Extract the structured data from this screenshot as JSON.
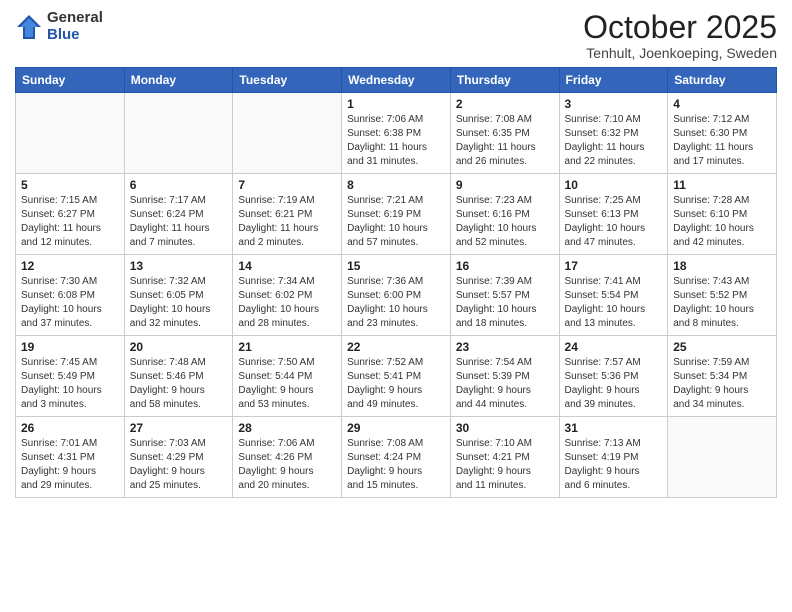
{
  "header": {
    "logo_general": "General",
    "logo_blue": "Blue",
    "month_title": "October 2025",
    "location": "Tenhult, Joenkoeping, Sweden"
  },
  "days_of_week": [
    "Sunday",
    "Monday",
    "Tuesday",
    "Wednesday",
    "Thursday",
    "Friday",
    "Saturday"
  ],
  "weeks": [
    [
      {
        "day": "",
        "info": ""
      },
      {
        "day": "",
        "info": ""
      },
      {
        "day": "",
        "info": ""
      },
      {
        "day": "1",
        "info": "Sunrise: 7:06 AM\nSunset: 6:38 PM\nDaylight: 11 hours\nand 31 minutes."
      },
      {
        "day": "2",
        "info": "Sunrise: 7:08 AM\nSunset: 6:35 PM\nDaylight: 11 hours\nand 26 minutes."
      },
      {
        "day": "3",
        "info": "Sunrise: 7:10 AM\nSunset: 6:32 PM\nDaylight: 11 hours\nand 22 minutes."
      },
      {
        "day": "4",
        "info": "Sunrise: 7:12 AM\nSunset: 6:30 PM\nDaylight: 11 hours\nand 17 minutes."
      }
    ],
    [
      {
        "day": "5",
        "info": "Sunrise: 7:15 AM\nSunset: 6:27 PM\nDaylight: 11 hours\nand 12 minutes."
      },
      {
        "day": "6",
        "info": "Sunrise: 7:17 AM\nSunset: 6:24 PM\nDaylight: 11 hours\nand 7 minutes."
      },
      {
        "day": "7",
        "info": "Sunrise: 7:19 AM\nSunset: 6:21 PM\nDaylight: 11 hours\nand 2 minutes."
      },
      {
        "day": "8",
        "info": "Sunrise: 7:21 AM\nSunset: 6:19 PM\nDaylight: 10 hours\nand 57 minutes."
      },
      {
        "day": "9",
        "info": "Sunrise: 7:23 AM\nSunset: 6:16 PM\nDaylight: 10 hours\nand 52 minutes."
      },
      {
        "day": "10",
        "info": "Sunrise: 7:25 AM\nSunset: 6:13 PM\nDaylight: 10 hours\nand 47 minutes."
      },
      {
        "day": "11",
        "info": "Sunrise: 7:28 AM\nSunset: 6:10 PM\nDaylight: 10 hours\nand 42 minutes."
      }
    ],
    [
      {
        "day": "12",
        "info": "Sunrise: 7:30 AM\nSunset: 6:08 PM\nDaylight: 10 hours\nand 37 minutes."
      },
      {
        "day": "13",
        "info": "Sunrise: 7:32 AM\nSunset: 6:05 PM\nDaylight: 10 hours\nand 32 minutes."
      },
      {
        "day": "14",
        "info": "Sunrise: 7:34 AM\nSunset: 6:02 PM\nDaylight: 10 hours\nand 28 minutes."
      },
      {
        "day": "15",
        "info": "Sunrise: 7:36 AM\nSunset: 6:00 PM\nDaylight: 10 hours\nand 23 minutes."
      },
      {
        "day": "16",
        "info": "Sunrise: 7:39 AM\nSunset: 5:57 PM\nDaylight: 10 hours\nand 18 minutes."
      },
      {
        "day": "17",
        "info": "Sunrise: 7:41 AM\nSunset: 5:54 PM\nDaylight: 10 hours\nand 13 minutes."
      },
      {
        "day": "18",
        "info": "Sunrise: 7:43 AM\nSunset: 5:52 PM\nDaylight: 10 hours\nand 8 minutes."
      }
    ],
    [
      {
        "day": "19",
        "info": "Sunrise: 7:45 AM\nSunset: 5:49 PM\nDaylight: 10 hours\nand 3 minutes."
      },
      {
        "day": "20",
        "info": "Sunrise: 7:48 AM\nSunset: 5:46 PM\nDaylight: 9 hours\nand 58 minutes."
      },
      {
        "day": "21",
        "info": "Sunrise: 7:50 AM\nSunset: 5:44 PM\nDaylight: 9 hours\nand 53 minutes."
      },
      {
        "day": "22",
        "info": "Sunrise: 7:52 AM\nSunset: 5:41 PM\nDaylight: 9 hours\nand 49 minutes."
      },
      {
        "day": "23",
        "info": "Sunrise: 7:54 AM\nSunset: 5:39 PM\nDaylight: 9 hours\nand 44 minutes."
      },
      {
        "day": "24",
        "info": "Sunrise: 7:57 AM\nSunset: 5:36 PM\nDaylight: 9 hours\nand 39 minutes."
      },
      {
        "day": "25",
        "info": "Sunrise: 7:59 AM\nSunset: 5:34 PM\nDaylight: 9 hours\nand 34 minutes."
      }
    ],
    [
      {
        "day": "26",
        "info": "Sunrise: 7:01 AM\nSunset: 4:31 PM\nDaylight: 9 hours\nand 29 minutes."
      },
      {
        "day": "27",
        "info": "Sunrise: 7:03 AM\nSunset: 4:29 PM\nDaylight: 9 hours\nand 25 minutes."
      },
      {
        "day": "28",
        "info": "Sunrise: 7:06 AM\nSunset: 4:26 PM\nDaylight: 9 hours\nand 20 minutes."
      },
      {
        "day": "29",
        "info": "Sunrise: 7:08 AM\nSunset: 4:24 PM\nDaylight: 9 hours\nand 15 minutes."
      },
      {
        "day": "30",
        "info": "Sunrise: 7:10 AM\nSunset: 4:21 PM\nDaylight: 9 hours\nand 11 minutes."
      },
      {
        "day": "31",
        "info": "Sunrise: 7:13 AM\nSunset: 4:19 PM\nDaylight: 9 hours\nand 6 minutes."
      },
      {
        "day": "",
        "info": ""
      }
    ]
  ]
}
